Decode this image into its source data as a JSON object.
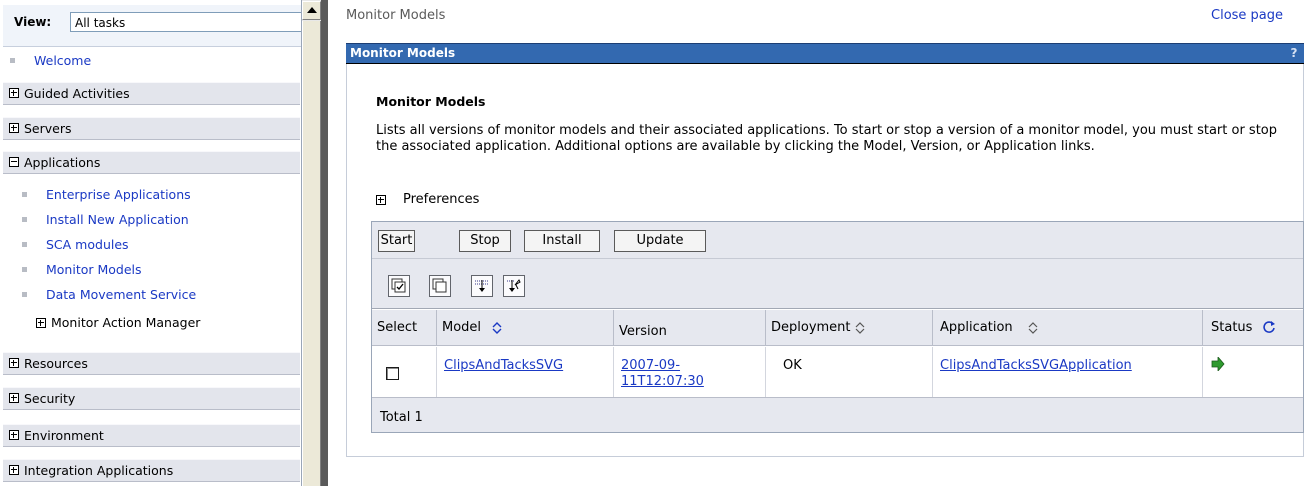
{
  "nav": {
    "view_label": "View:",
    "view_value": "All tasks",
    "welcome": "Welcome",
    "sections": [
      "Guided Activities",
      "Servers",
      "Applications",
      "Resources",
      "Security",
      "Environment",
      "Integration Applications"
    ],
    "applications_items": [
      "Enterprise Applications",
      "Install New Application",
      "SCA modules",
      "Monitor Models",
      "Data Movement Service"
    ],
    "monitor_action_manager": "Monitor Action Manager"
  },
  "header": {
    "breadcrumb": "Monitor Models",
    "close_page": "Close page"
  },
  "portlet": {
    "title": "Monitor Models",
    "help": "?",
    "heading": "Monitor Models",
    "description": "Lists all versions of monitor models and their associated applications. To start or stop a version of a monitor model, you must start or stop the associated application. Additional options are available by clicking the Model, Version, or Application links.",
    "preferences": "Preferences"
  },
  "toolbar": {
    "buttons": [
      "Start",
      "Stop",
      "Install",
      "Update"
    ],
    "icons": [
      "select-all-icon",
      "deselect-all-icon",
      "show-filter-icon",
      "clear-filter-icon"
    ]
  },
  "table": {
    "headers": [
      "Select",
      "Model",
      "Version",
      "Deployment",
      "Application",
      "Status"
    ],
    "rows": [
      {
        "model": "ClipsAndTacksSVG",
        "version_line1": "2007-09-",
        "version_line2": "11T12:07:30",
        "deployment": "OK",
        "application": "ClipsAndTacksSVGApplication",
        "status": "running-arrow-icon",
        "selected": false
      }
    ],
    "total": "Total 1"
  },
  "colors": {
    "link": "#1a39c4",
    "title_bar": "#3369b0",
    "status_green": "#2e9a2e"
  }
}
